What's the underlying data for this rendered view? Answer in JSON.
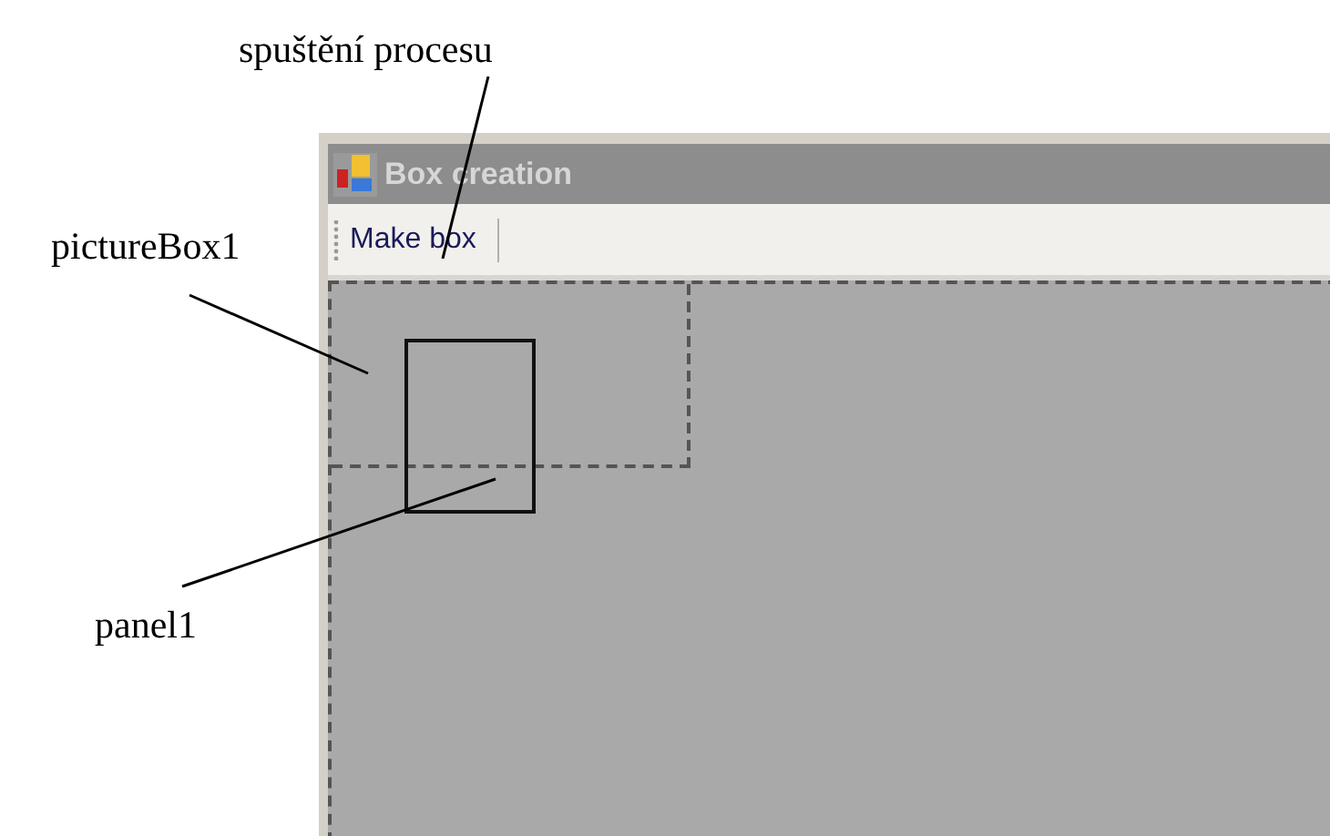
{
  "annotations": [
    {
      "text": "spuštění procesu"
    },
    {
      "text": "pictureBox1"
    },
    {
      "text": "panel1"
    }
  ],
  "window": {
    "title": "Box creation"
  },
  "toolbar": {
    "buttons": [
      "Make box"
    ]
  }
}
